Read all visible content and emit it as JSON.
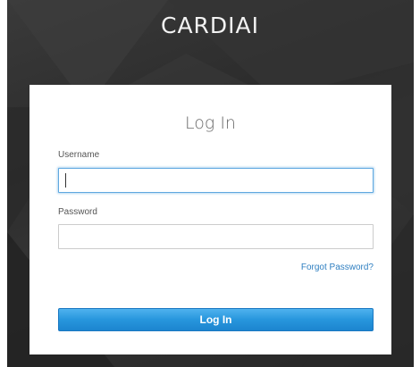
{
  "brand": {
    "name": "CARDIAI"
  },
  "login_form": {
    "title": "Log In",
    "username": {
      "label": "Username",
      "value": "",
      "placeholder": ""
    },
    "password": {
      "label": "Password",
      "value": "",
      "placeholder": ""
    },
    "forgot_password_label": "Forgot Password?",
    "submit_label": "Log In"
  },
  "colors": {
    "background": "#2e2e2e",
    "brand_text": "#f2f2f2",
    "link": "#2f7fc1",
    "button_top": "#4fb2ee",
    "button_bottom": "#1c85cf",
    "focus_border": "#5fa8e0"
  }
}
